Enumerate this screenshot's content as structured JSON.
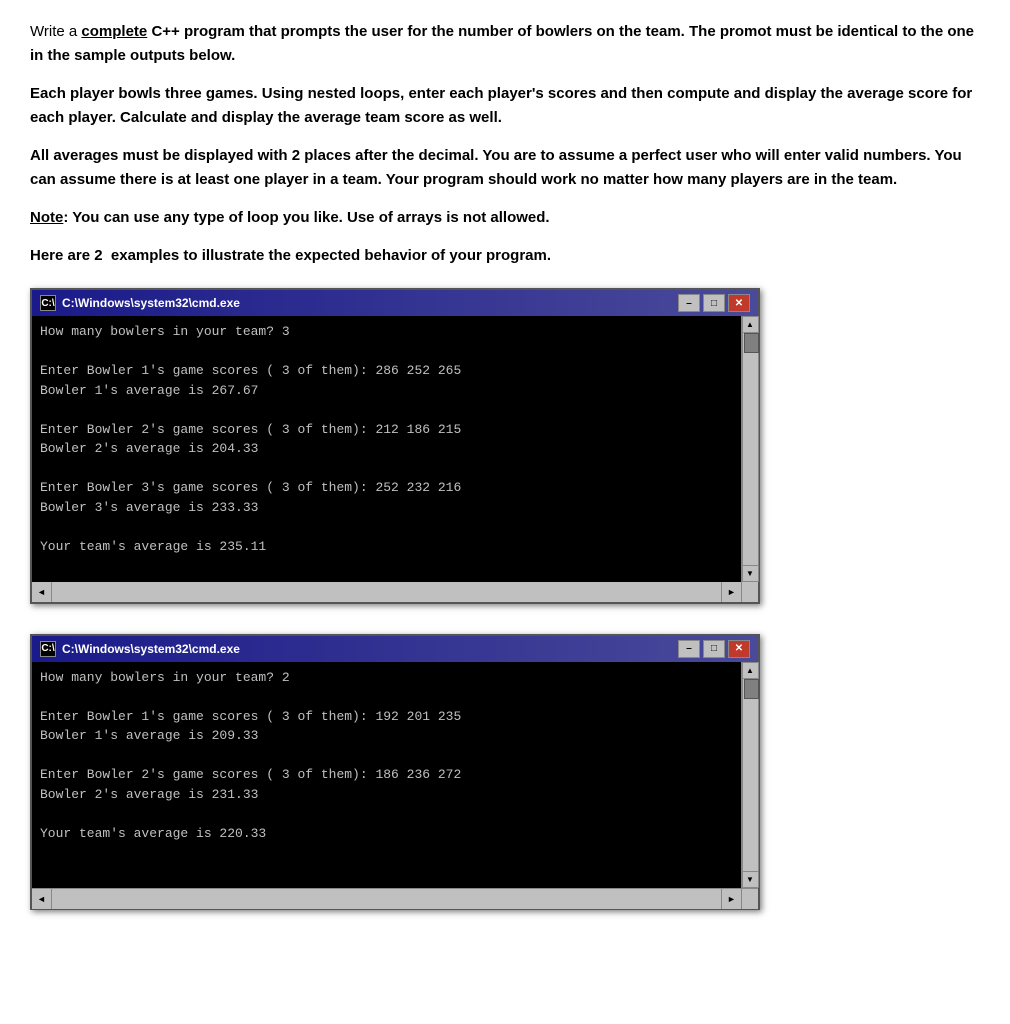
{
  "instructions": {
    "paragraph1": "Write a complete C++ program that prompts the user for the number of bowlers on the team. The promot must be identical to the one in the sample outputs below.",
    "paragraph1_underline": "complete",
    "paragraph2": "Each player bowls three games. Using nested loops, enter each player's scores and then compute and display the average score for each player. Calculate and display the average team score as well.",
    "paragraph3": "All averages must be displayed with 2 places after the decimal. You are to assume a perfect user who will enter valid numbers. You can assume there is at least one player in a team. Your program should work no matter how many players are in the team.",
    "paragraph4_note": "Note",
    "paragraph4_text": ": You can use any type of loop you like. Use of arrays is not allowed.",
    "paragraph5": "Here are 2  examples to illustrate the expected behavior of your program."
  },
  "window1": {
    "title": "C:\\Windows\\system32\\cmd.exe",
    "icon_label": "C:\\",
    "btn_minimize": "–",
    "btn_restore": "□",
    "btn_close": "✕",
    "lines": [
      "How many bowlers in your team? 3",
      "",
      "Enter Bowler 1's game scores ( 3 of them): 286 252 265",
      "Bowler 1's average is 267.67",
      "",
      "Enter Bowler 2's game scores ( 3 of them): 212 186 215",
      "Bowler 2's average is 204.33",
      "",
      "Enter Bowler 3's game scores ( 3 of them): 252 232 216",
      "Bowler 3's average is 233.33",
      "",
      "Your team's average is 235.11",
      ""
    ]
  },
  "window2": {
    "title": "C:\\Windows\\system32\\cmd.exe",
    "icon_label": "C:\\",
    "btn_minimize": "–",
    "btn_restore": "□",
    "btn_close": "✕",
    "lines": [
      "How many bowlers in your team? 2",
      "",
      "Enter Bowler 1's game scores ( 3 of them): 192 201 235",
      "Bowler 1's average is 209.33",
      "",
      "Enter Bowler 2's game scores ( 3 of them): 186 236 272",
      "Bowler 2's average is 231.33",
      "",
      "Your team's average is 220.33",
      "",
      ""
    ]
  }
}
